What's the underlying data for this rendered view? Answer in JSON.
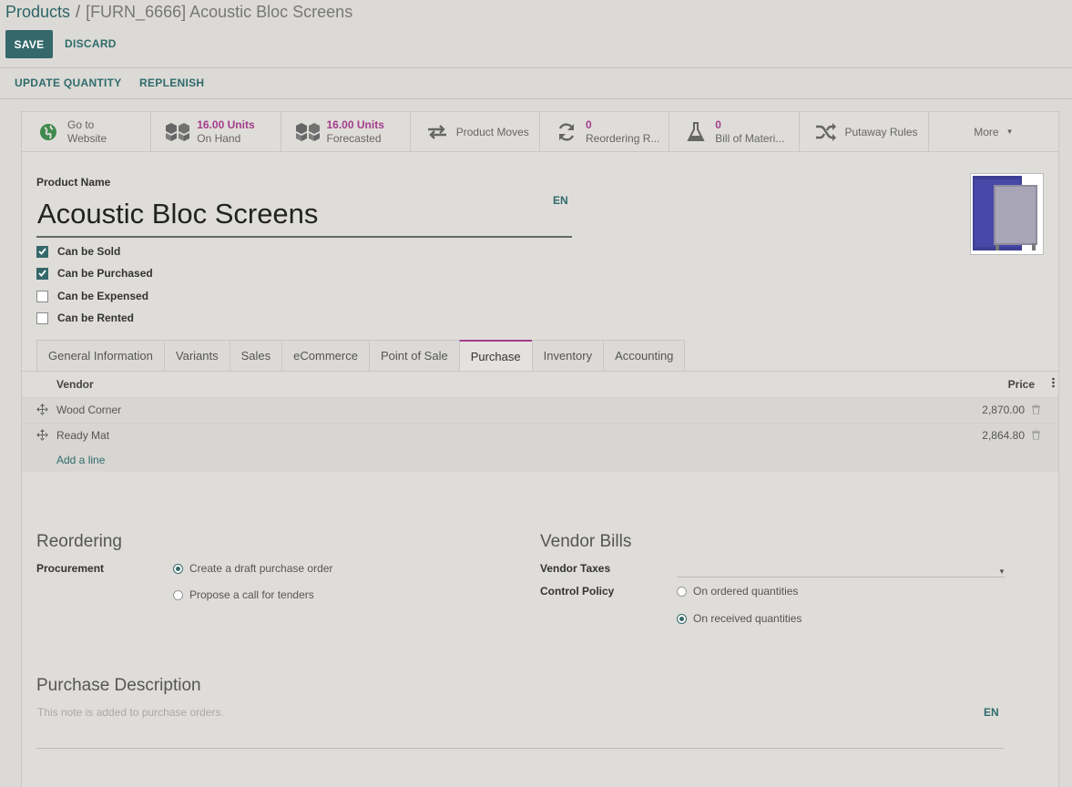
{
  "breadcrumb": {
    "parent": "Products",
    "separator": "/",
    "current": "[FURN_6666] Acoustic Bloc Screens"
  },
  "control": {
    "save": "SAVE",
    "discard": "DISCARD"
  },
  "actions": {
    "update_quantity": "UPDATE QUANTITY",
    "replenish": "REPLENISH"
  },
  "stat_buttons": {
    "website": {
      "line1": "Go to",
      "line2": "Website",
      "icon": "globe-icon"
    },
    "on_hand": {
      "value": "16.00 Units",
      "label": "On Hand",
      "icon": "cubes-icon"
    },
    "forecasted": {
      "value": "16.00 Units",
      "label": "Forecasted",
      "icon": "cubes-icon"
    },
    "product_moves": {
      "label": "Product Moves",
      "icon": "exchange-icon"
    },
    "reordering": {
      "value": "0",
      "label": "Reordering R...",
      "icon": "refresh-icon"
    },
    "bom": {
      "value": "0",
      "label": "Bill of Materi...",
      "icon": "flask-icon"
    },
    "putaway": {
      "label": "Putaway Rules",
      "icon": "random-icon"
    },
    "more": {
      "label": "More"
    }
  },
  "product": {
    "name_label": "Product Name",
    "name": "Acoustic Bloc Screens",
    "lang": "EN",
    "options": [
      {
        "label": "Can be Sold",
        "checked": true
      },
      {
        "label": "Can be Purchased",
        "checked": true
      },
      {
        "label": "Can be Expensed",
        "checked": false
      },
      {
        "label": "Can be Rented",
        "checked": false
      }
    ]
  },
  "tabs": [
    "General Information",
    "Variants",
    "Sales",
    "eCommerce",
    "Point of Sale",
    "Purchase",
    "Inventory",
    "Accounting"
  ],
  "active_tab": "Purchase",
  "vendor_table": {
    "headers": {
      "vendor": "Vendor",
      "price": "Price"
    },
    "rows": [
      {
        "vendor": "Wood Corner",
        "price": "2,870.00"
      },
      {
        "vendor": "Ready Mat",
        "price": "2,864.80"
      }
    ],
    "add_line": "Add a line"
  },
  "reordering": {
    "title": "Reordering",
    "procurement_label": "Procurement",
    "options": [
      {
        "label": "Create a draft purchase order",
        "selected": true
      },
      {
        "label": "Propose a call for tenders",
        "selected": false
      }
    ]
  },
  "vendor_bills": {
    "title": "Vendor Bills",
    "taxes_label": "Vendor Taxes",
    "taxes_value": "",
    "control_label": "Control Policy",
    "options": [
      {
        "label": "On ordered quantities",
        "selected": false
      },
      {
        "label": "On received quantities",
        "selected": true
      }
    ]
  },
  "purchase_description": {
    "title": "Purchase Description",
    "placeholder": "This note is added to purchase orders.",
    "lang": "EN"
  },
  "colors": {
    "primary": "#35686a",
    "accent": "#a33d8c",
    "background": "#dcdad6"
  }
}
